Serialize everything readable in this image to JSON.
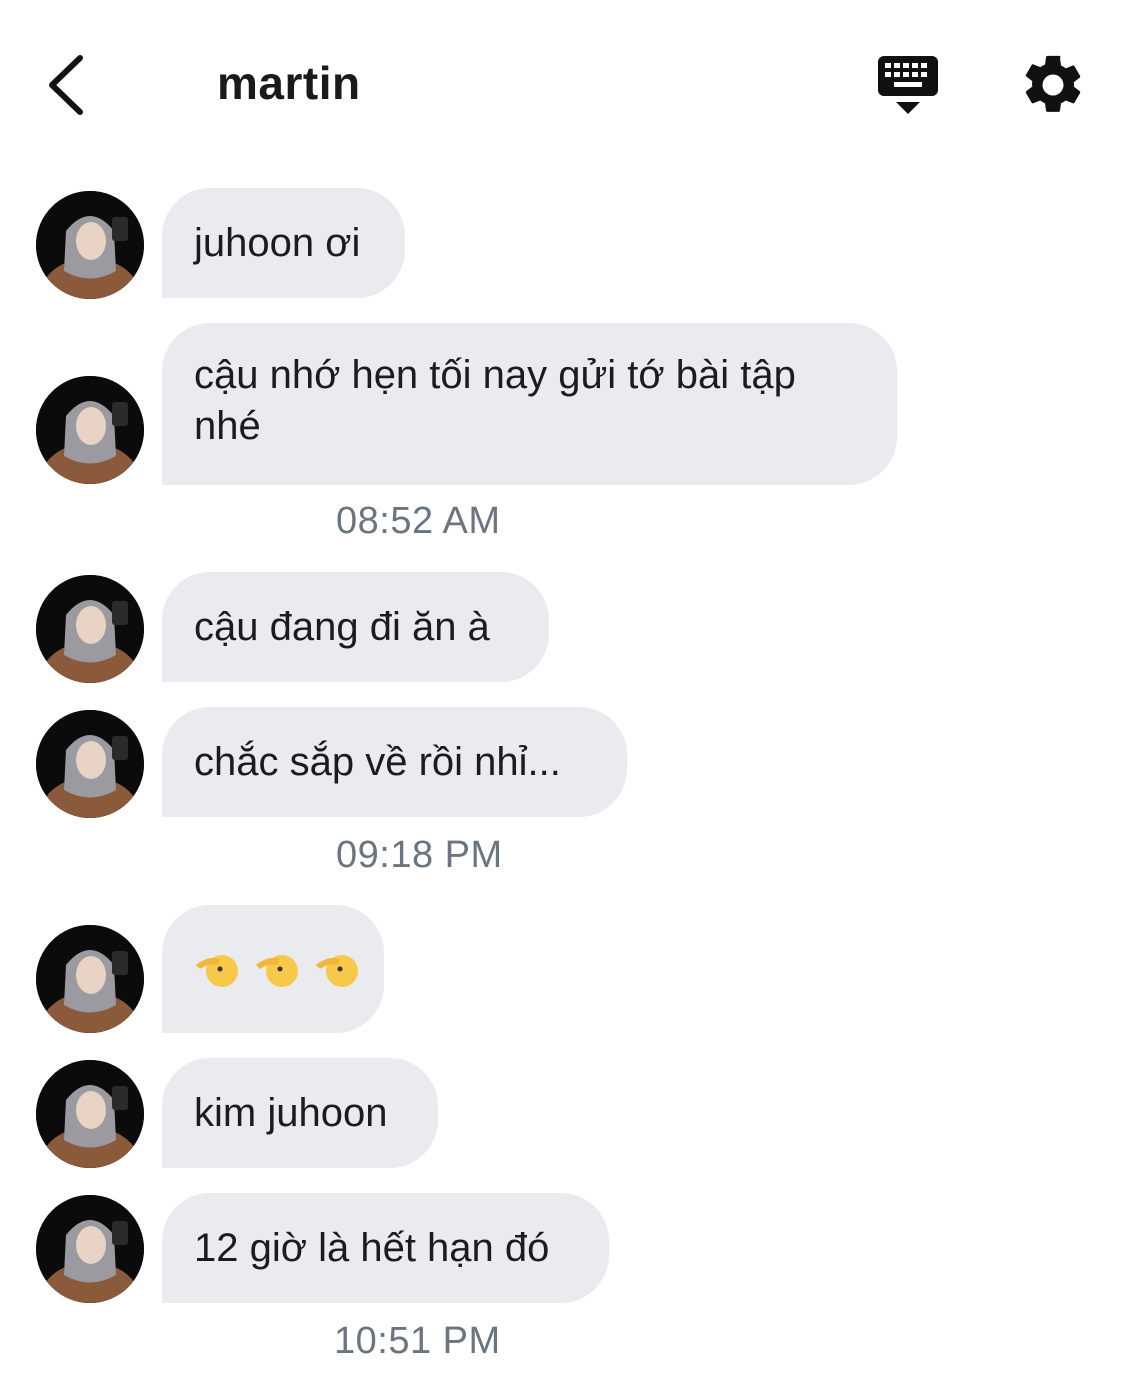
{
  "header": {
    "title": "martin",
    "back_icon": "chevron-left-icon",
    "keyboard_icon": "keyboard-dismiss-icon",
    "settings_icon": "gear-icon"
  },
  "messages": [
    {
      "text": "juhoon ơi"
    },
    {
      "text": "cậu nhớ hẹn tối nay gửi tớ bài tập nhé"
    },
    {
      "text": "cậu đang đi ăn à"
    },
    {
      "text": "chắc sắp về rồi nhỉ..."
    },
    {
      "text": "",
      "emoji": [
        "saluting-face-icon",
        "saluting-face-icon",
        "saluting-face-icon"
      ]
    },
    {
      "text": "kim juhoon"
    },
    {
      "text": "12 giờ là hết hạn đó"
    }
  ],
  "timestamps": [
    "08:52 AM",
    "09:18 PM",
    "10:51 PM"
  ],
  "colors": {
    "bubble": "#e9ebef",
    "timestamp": "#6b7580",
    "icon": "#111111"
  }
}
